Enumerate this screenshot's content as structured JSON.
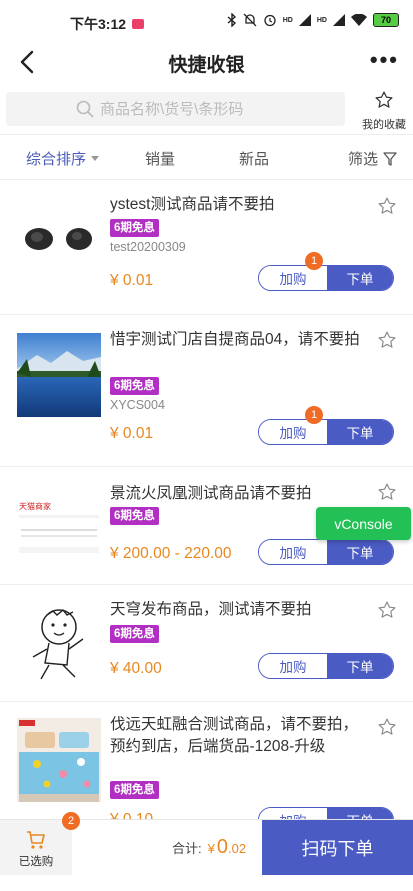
{
  "status": {
    "time": "下午3:12",
    "signal1": "HD",
    "signal2": "HD",
    "battery": "70"
  },
  "nav": {
    "title": "快捷收银"
  },
  "search": {
    "placeholder": "商品名称\\货号\\条形码"
  },
  "favorites": {
    "label": "我的收藏"
  },
  "filters": [
    {
      "label": "综合排序"
    },
    {
      "label": "销量"
    },
    {
      "label": "新品"
    },
    {
      "label": "筛选"
    }
  ],
  "products": [
    {
      "name": "ystest测试商品请不要拍",
      "tag": "6期免息",
      "sku": "test20200309",
      "price": "¥ 0.01",
      "add_label": "加购",
      "order_label": "下单",
      "badge": "1"
    },
    {
      "name": "惜宇测试门店自提商品04，请不要拍",
      "tag": "6期免息",
      "sku": "XYCS004",
      "price": "¥ 0.01",
      "add_label": "加购",
      "order_label": "下单",
      "badge": "1"
    },
    {
      "name": "景流火凤凰测试商品请不要拍",
      "tag": "6期免息",
      "sku": "",
      "price": "¥ 200.00 - 220.00",
      "add_label": "加购",
      "order_label": "下单",
      "badge": ""
    },
    {
      "name": "天穹发布商品，测试请不要拍",
      "tag": "6期免息",
      "sku": "",
      "price": "¥ 40.00",
      "add_label": "加购",
      "order_label": "下单",
      "badge": ""
    },
    {
      "name": "伐远天虹融合测试商品，请不要拍，预约到店，后端货品-1208-升级",
      "tag": "6期免息",
      "sku": "",
      "price": "¥ 0.10",
      "add_label": "加购",
      "order_label": "下单",
      "badge": ""
    }
  ],
  "image_texts": {
    "logo_text": "天猫商家"
  },
  "vconsole": {
    "label": "vConsole"
  },
  "cart": {
    "label": "已选购",
    "badge": "2"
  },
  "total": {
    "label": "合计:",
    "symbol": "¥",
    "integer": "0",
    "decimal": ".02"
  },
  "scan_button": {
    "label": "扫码下单"
  },
  "colors": {
    "accent": "#4a5bc3",
    "price": "#e8881f",
    "tag": "#b12fc2",
    "badge": "#f06b23",
    "vconsole": "#22c055"
  }
}
